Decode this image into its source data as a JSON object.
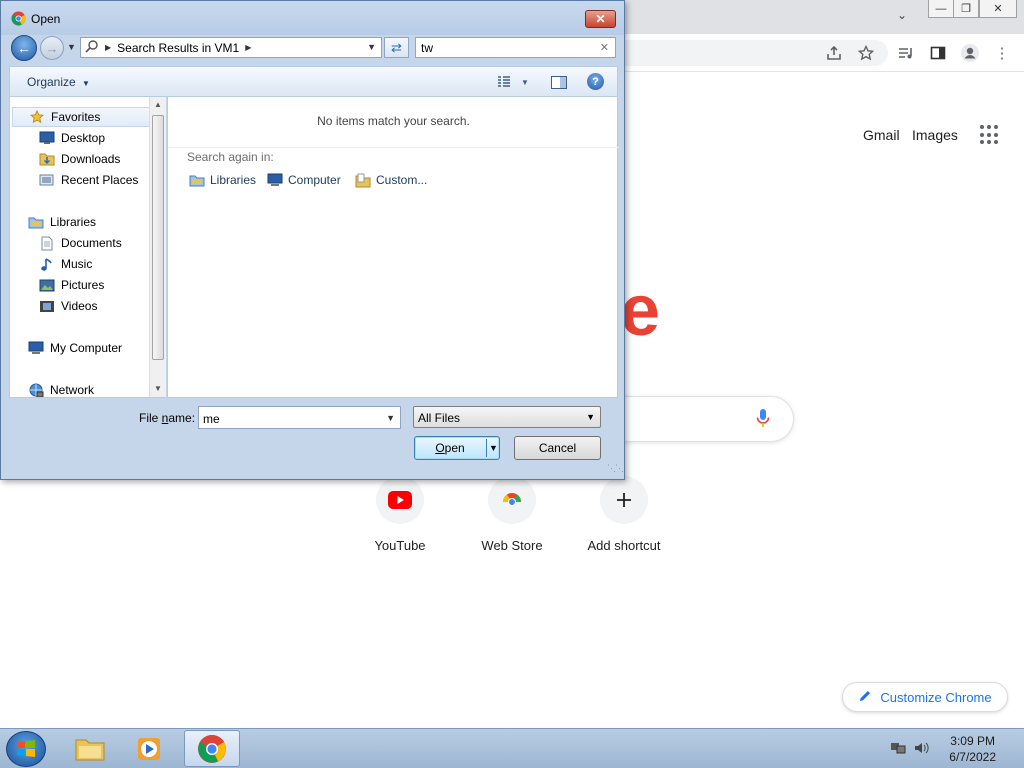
{
  "dialog": {
    "title": "Open",
    "address": "Search Results in VM1",
    "search_value": "tw",
    "organize_label": "Organize",
    "no_items_text": "No items match your search.",
    "search_again_label": "Search again in:",
    "search_again_links": [
      {
        "label": "Libraries",
        "icon": "libraries-icon"
      },
      {
        "label": "Computer",
        "icon": "computer-icon"
      },
      {
        "label": "Custom...",
        "icon": "custom-folder-icon"
      }
    ],
    "nav": {
      "favorites": "Favorites",
      "desktop": "Desktop",
      "downloads": "Downloads",
      "recent_places": "Recent Places",
      "libraries": "Libraries",
      "documents": "Documents",
      "music": "Music",
      "pictures": "Pictures",
      "videos": "Videos",
      "my_computer": "My Computer",
      "network": "Network"
    },
    "file_name_label_pre": "File ",
    "file_name_label_u": "n",
    "file_name_label_post": "ame:",
    "file_name_value": "me",
    "file_type_value": "All Files",
    "open_label_u": "O",
    "open_label_rest": "pen",
    "cancel_label": "Cancel",
    "close_glyph": "✕"
  },
  "chrome": {
    "gmail": "Gmail",
    "images": "Images",
    "shortcuts": [
      {
        "label": "YouTube",
        "icon": "youtube-icon"
      },
      {
        "label": "Web Store",
        "icon": "web-store-icon"
      },
      {
        "label": "Add shortcut",
        "icon": "plus-icon"
      }
    ],
    "customize_label": "Customize Chrome",
    "logo_fragment": "e"
  },
  "taskbar": {
    "time": "3:09 PM",
    "date": "6/7/2022"
  },
  "colors": {
    "accent": "#1a73e8",
    "youtube_red": "#ff0000",
    "google_red": "#ea4335"
  }
}
